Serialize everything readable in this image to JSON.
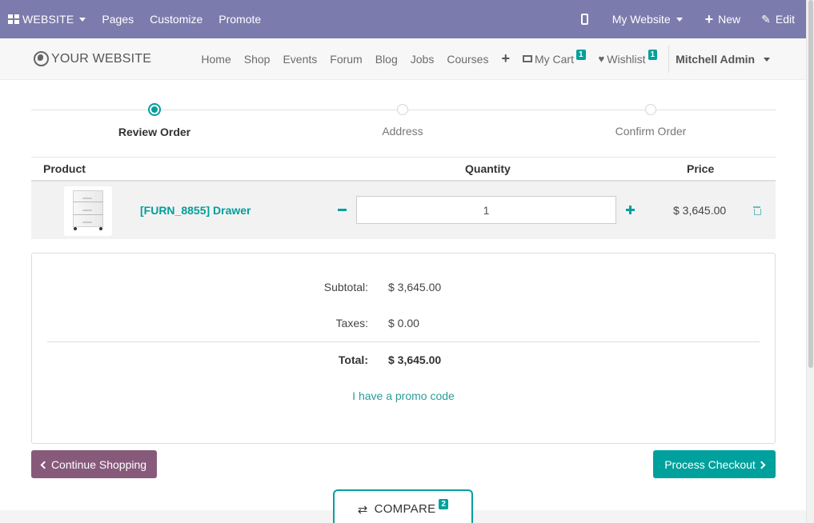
{
  "admin_bar": {
    "apps_label": "WEBSITE",
    "menu": [
      "Pages",
      "Customize",
      "Promote"
    ],
    "site_selector": "My Website",
    "new_label": "New",
    "edit_label": "Edit",
    "bg_color": "#7c7bad"
  },
  "header": {
    "logo_text": "YOUR WEBSITE",
    "nav": [
      "Home",
      "Shop",
      "Events",
      "Forum",
      "Blog",
      "Jobs",
      "Courses"
    ],
    "add_menu_icon": "plus-icon",
    "cart_label": "My Cart",
    "cart_count": "1",
    "wishlist_label": "Wishlist",
    "wishlist_count": "1",
    "user_name": "Mitchell Admin"
  },
  "wizard": {
    "steps": [
      "Review Order",
      "Address",
      "Confirm Order"
    ],
    "active_step": "Review Order"
  },
  "cart": {
    "columns": [
      "Product",
      "Quantity",
      "Price"
    ],
    "rows": [
      {
        "name": "[FURN_8855] Drawer",
        "quantity": "1",
        "price": "$ 3,645.00"
      }
    ]
  },
  "summary": {
    "subtotal_label": "Subtotal:",
    "subtotal": "$ 3,645.00",
    "taxes_label": "Taxes:",
    "taxes": "$ 0.00",
    "total_label": "Total:",
    "total": "$ 3,645.00",
    "promo_link": "I have a promo code"
  },
  "actions": {
    "continue_label": "Continue Shopping",
    "checkout_label": "Process Checkout"
  },
  "compare": {
    "label": "COMPARE",
    "count": "2"
  },
  "colors": {
    "primary": "#00a09d",
    "secondary": "#875a7b"
  }
}
